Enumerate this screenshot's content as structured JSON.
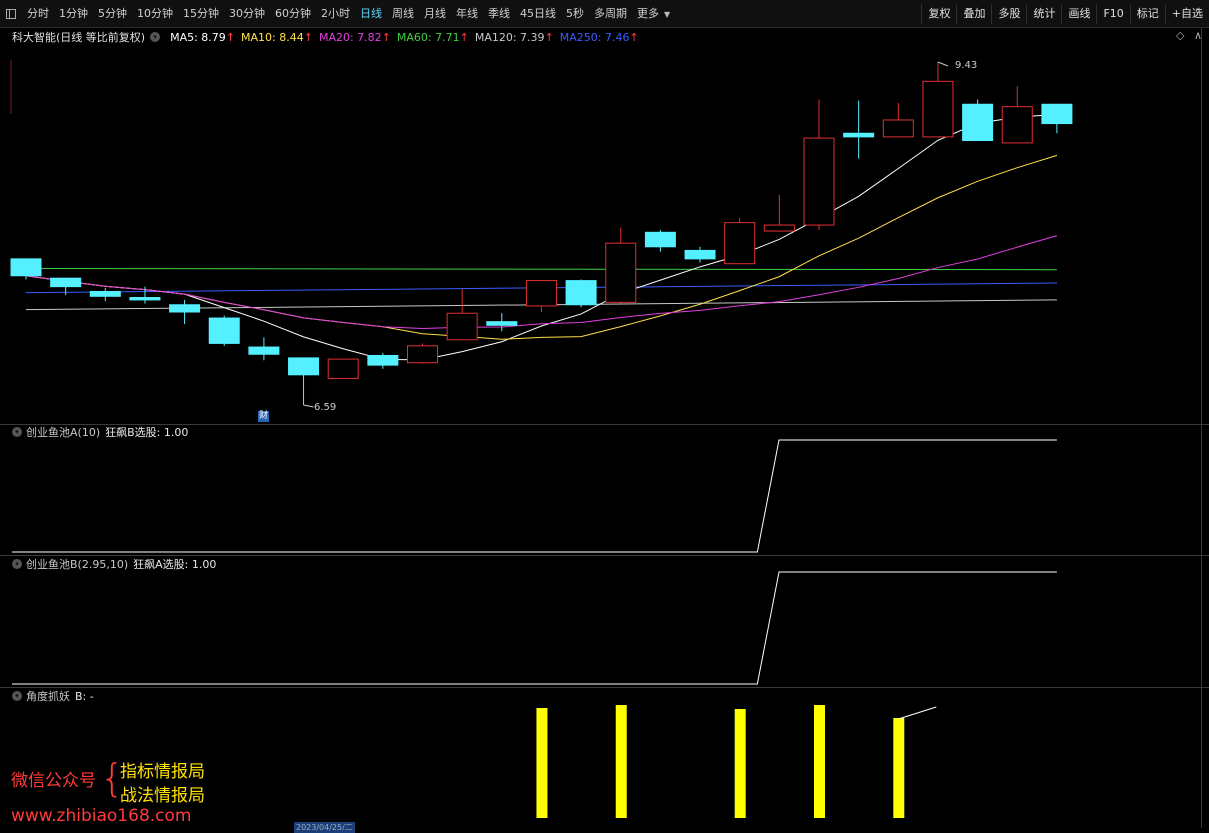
{
  "toolbar": {
    "periods": [
      "分时",
      "1分钟",
      "5分钟",
      "10分钟",
      "15分钟",
      "30分钟",
      "60分钟",
      "2小时",
      "日线",
      "周线",
      "月线",
      "年线",
      "季线",
      "45日线",
      "5秒",
      "多周期",
      "更多"
    ],
    "active_period": "日线",
    "right_buttons": [
      "复权",
      "叠加",
      "多股",
      "统计",
      "画线",
      "F10",
      "标记",
      "+自选"
    ]
  },
  "main": {
    "stock_title": "科大智能(日线 等比前复权)",
    "ma": [
      {
        "label": "MA5: 8.79",
        "color": "#ffffff"
      },
      {
        "label": "MA10: 8.44",
        "color": "#ffe14a"
      },
      {
        "label": "MA20: 7.82",
        "color": "#e040e0"
      },
      {
        "label": "MA60: 7.71",
        "color": "#40d040"
      },
      {
        "label": "MA120: 7.39",
        "color": "#c8c8c8"
      },
      {
        "label": "MA250: 7.46",
        "color": "#3a5cff"
      }
    ],
    "up_arrow": "↑",
    "high_label": "9.43",
    "low_label": "6.59",
    "cai_badge": "财"
  },
  "panel1": {
    "title": "创业鱼池A(10)",
    "value_label": "狂飙B选股: 1.00"
  },
  "panel2": {
    "title": "创业鱼池B(2.95,10)",
    "value_label": "狂飙A选股: 1.00"
  },
  "panel3": {
    "title": "角度抓妖",
    "value_label": "B: -"
  },
  "date_tag": "2023/04/25/二",
  "watermark": {
    "left_text": "微信公众号",
    "brace": "{",
    "line1": "指标情报局",
    "line2": "战法情报局",
    "url": "www.zhibiao168.com"
  },
  "colors": {
    "up": "#e03030",
    "down": "#55f0ff",
    "signal": "#ffff00"
  },
  "chart_data": {
    "type": "candlestick",
    "y_scale_hint": "price",
    "candles": [
      {
        "o": 7.8,
        "c": 7.66,
        "h": 7.8,
        "l": 7.63
      },
      {
        "o": 7.64,
        "c": 7.57,
        "h": 7.64,
        "l": 7.5
      },
      {
        "o": 7.53,
        "c": 7.49,
        "h": 7.56,
        "l": 7.45
      },
      {
        "o": 7.48,
        "c": 7.46,
        "h": 7.57,
        "l": 7.43
      },
      {
        "o": 7.42,
        "c": 7.36,
        "h": 7.46,
        "l": 7.26
      },
      {
        "o": 7.31,
        "c": 7.1,
        "h": 7.33,
        "l": 7.08
      },
      {
        "o": 7.07,
        "c": 7.01,
        "h": 7.15,
        "l": 6.96
      },
      {
        "o": 6.98,
        "c": 6.84,
        "h": 6.98,
        "l": 6.59
      },
      {
        "o": 6.81,
        "c": 6.97,
        "h": 6.97,
        "l": 6.81
      },
      {
        "o": 7.0,
        "c": 6.92,
        "h": 7.02,
        "l": 6.89
      },
      {
        "o": 6.94,
        "c": 7.08,
        "h": 7.1,
        "l": 6.93
      },
      {
        "o": 7.13,
        "c": 7.35,
        "h": 7.55,
        "l": 7.13
      },
      {
        "o": 7.28,
        "c": 7.25,
        "h": 7.35,
        "l": 7.2
      },
      {
        "o": 7.41,
        "c": 7.62,
        "h": 7.62,
        "l": 7.36
      },
      {
        "o": 7.62,
        "c": 7.42,
        "h": 7.63,
        "l": 7.4
      },
      {
        "o": 7.44,
        "c": 7.93,
        "h": 8.06,
        "l": 7.43
      },
      {
        "o": 8.02,
        "c": 7.9,
        "h": 8.04,
        "l": 7.86
      },
      {
        "o": 7.87,
        "c": 7.8,
        "h": 7.9,
        "l": 7.77
      },
      {
        "o": 7.76,
        "c": 8.1,
        "h": 8.14,
        "l": 7.76
      },
      {
        "o": 8.03,
        "c": 8.08,
        "h": 8.33,
        "l": 8.03
      },
      {
        "o": 8.08,
        "c": 8.8,
        "h": 9.12,
        "l": 8.04
      },
      {
        "o": 8.84,
        "c": 8.81,
        "h": 9.11,
        "l": 8.63
      },
      {
        "o": 8.81,
        "c": 8.95,
        "h": 9.09,
        "l": 8.81
      },
      {
        "o": 8.81,
        "c": 9.27,
        "h": 9.43,
        "l": 8.81
      },
      {
        "o": 9.08,
        "c": 8.78,
        "h": 9.12,
        "l": 8.78
      },
      {
        "o": 8.76,
        "c": 9.06,
        "h": 9.23,
        "l": 8.76
      },
      {
        "o": 9.08,
        "c": 8.92,
        "h": 9.08,
        "l": 8.84
      }
    ],
    "signal_bars_indices": [
      13,
      15,
      18,
      20,
      22
    ]
  }
}
